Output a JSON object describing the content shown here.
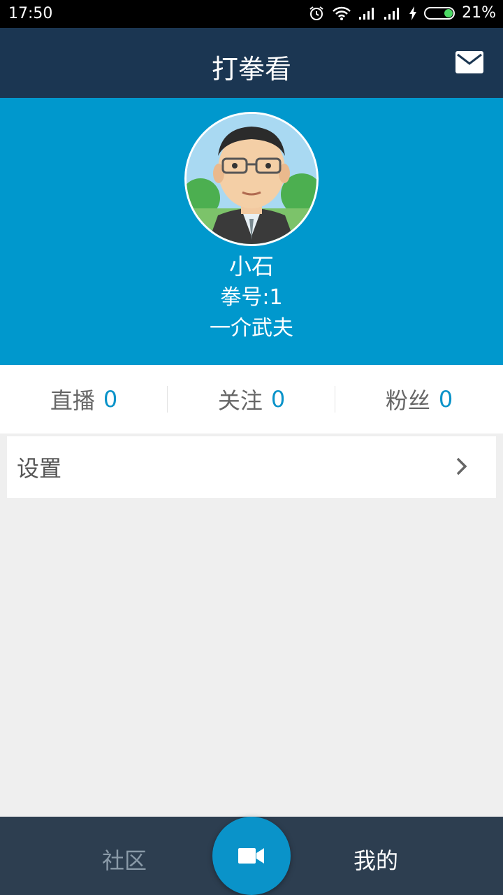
{
  "status_bar": {
    "time": "17:50",
    "battery_text": "21%",
    "icons": [
      "alarm-icon",
      "wifi-icon",
      "signal-icon",
      "signal-icon",
      "charging-icon",
      "battery-icon"
    ]
  },
  "header": {
    "title": "打拳看",
    "mail_icon": "mail-icon"
  },
  "profile": {
    "name": "小石",
    "id_text": "拳号:1",
    "bio": "一介武夫",
    "background_color": "#0098cd"
  },
  "stats": [
    {
      "label": "直播",
      "value": "0"
    },
    {
      "label": "关注",
      "value": "0"
    },
    {
      "label": "粉丝",
      "value": "0"
    }
  ],
  "menu": {
    "settings_label": "设置",
    "chevron_icon": "chevron-right-icon"
  },
  "tabbar": {
    "community_label": "社区",
    "mine_label": "我的",
    "record_icon": "video-camera-icon",
    "accent_color": "#0a93c9",
    "background_color": "#2d3e50"
  }
}
